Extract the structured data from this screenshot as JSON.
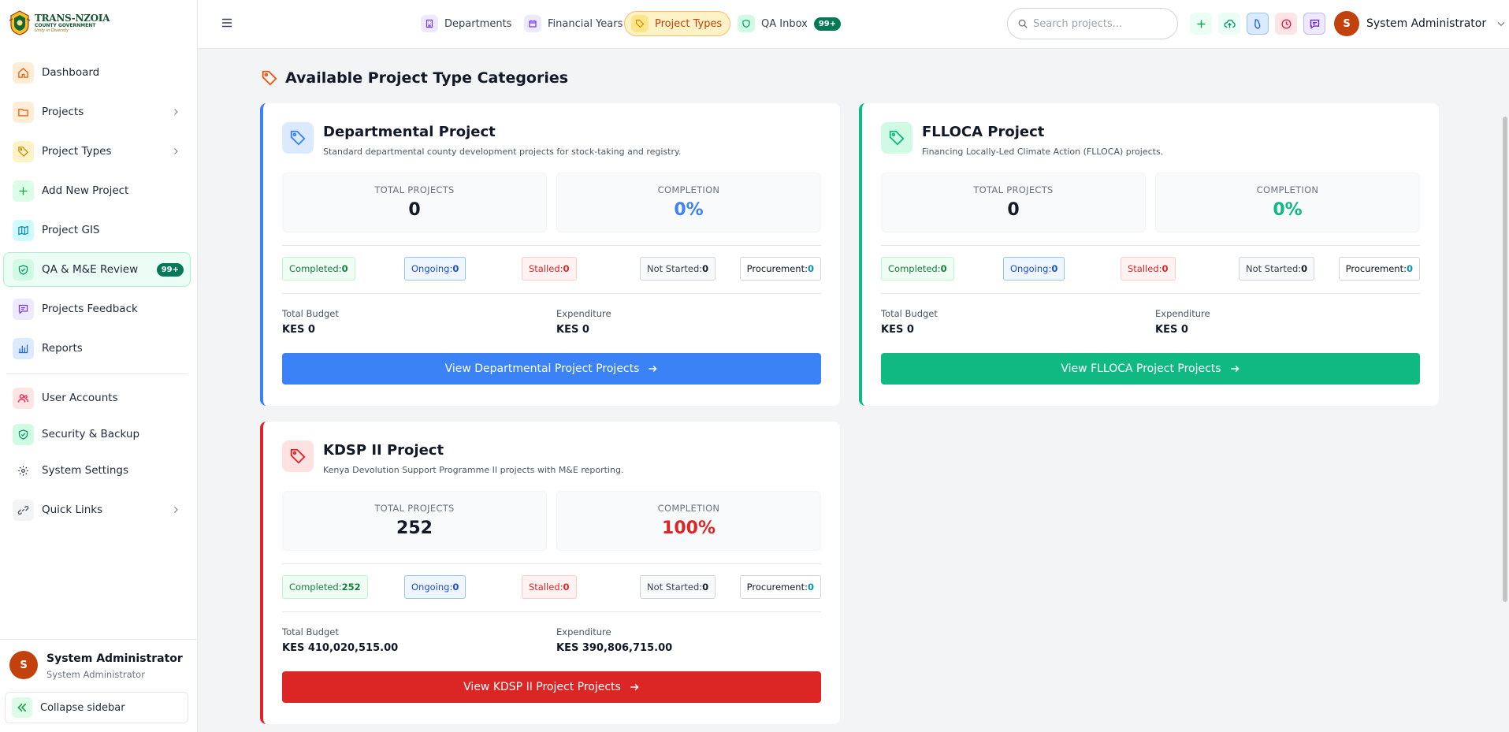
{
  "logo": {
    "main": "TRANS-NZOIA",
    "sub": "COUNTY GOVERNMENT",
    "motto": "Unity in Diversity"
  },
  "sidebar": {
    "items": [
      {
        "label": "Dashboard"
      },
      {
        "label": "Projects"
      },
      {
        "label": "Project Types"
      },
      {
        "label": "Add New Project"
      },
      {
        "label": "Project GIS"
      },
      {
        "label": "QA & M&E Review",
        "badge": "99+"
      },
      {
        "label": "Projects Feedback"
      },
      {
        "label": "Reports"
      },
      {
        "label": "User Accounts"
      },
      {
        "label": "Security & Backup"
      },
      {
        "label": "System Settings"
      },
      {
        "label": "Quick Links"
      }
    ],
    "user": {
      "initial": "S",
      "name": "System Administrator",
      "role": "System Administrator"
    },
    "collapse_label": "Collapse sidebar"
  },
  "topbar": {
    "tabs": [
      {
        "label": "Departments"
      },
      {
        "label": "Financial Years"
      },
      {
        "label": "Project Types"
      },
      {
        "label": "QA Inbox",
        "badge": "99+"
      }
    ],
    "search_placeholder": "Search projects...",
    "user": {
      "initial": "S",
      "name": "System Administrator"
    }
  },
  "main": {
    "section_title": "Available Project Type Categories",
    "labels": {
      "total_projects": "TOTAL PROJECTS",
      "completion": "COMPLETION",
      "completed": "Completed:",
      "ongoing": "Ongoing:",
      "stalled": "Stalled:",
      "not_started": "Not Started:",
      "procurement": "Procurement:",
      "total_budget": "Total Budget",
      "expenditure": "Expenditure"
    },
    "cards": [
      {
        "title": "Departmental Project",
        "description": "Standard departmental county development projects for stock-taking and registry.",
        "total_projects": "0",
        "completion": "0%",
        "completed": "0",
        "ongoing": "0",
        "stalled": "0",
        "not_started": "0",
        "procurement": "0",
        "total_budget": "KES 0",
        "expenditure": "KES 0",
        "button_label": "View Departmental Project Projects",
        "color": "#3b82f6"
      },
      {
        "title": "FLLOCA Project",
        "description": "Financing Locally-Led Climate Action (FLLOCA) projects.",
        "total_projects": "0",
        "completion": "0%",
        "completed": "0",
        "ongoing": "0",
        "stalled": "0",
        "not_started": "0",
        "procurement": "0",
        "total_budget": "KES 0",
        "expenditure": "KES 0",
        "button_label": "View FLLOCA Project Projects",
        "color": "#10b981"
      },
      {
        "title": "KDSP II Project",
        "description": "Kenya Devolution Support Programme II projects with M&E reporting.",
        "total_projects": "252",
        "completion": "100%",
        "completed": "252",
        "ongoing": "0",
        "stalled": "0",
        "not_started": "0",
        "procurement": "0",
        "total_budget": "KES 410,020,515.00",
        "expenditure": "KES 390,806,715.00",
        "button_label": "View KDSP II Project Projects",
        "color": "#dc2626"
      }
    ]
  }
}
